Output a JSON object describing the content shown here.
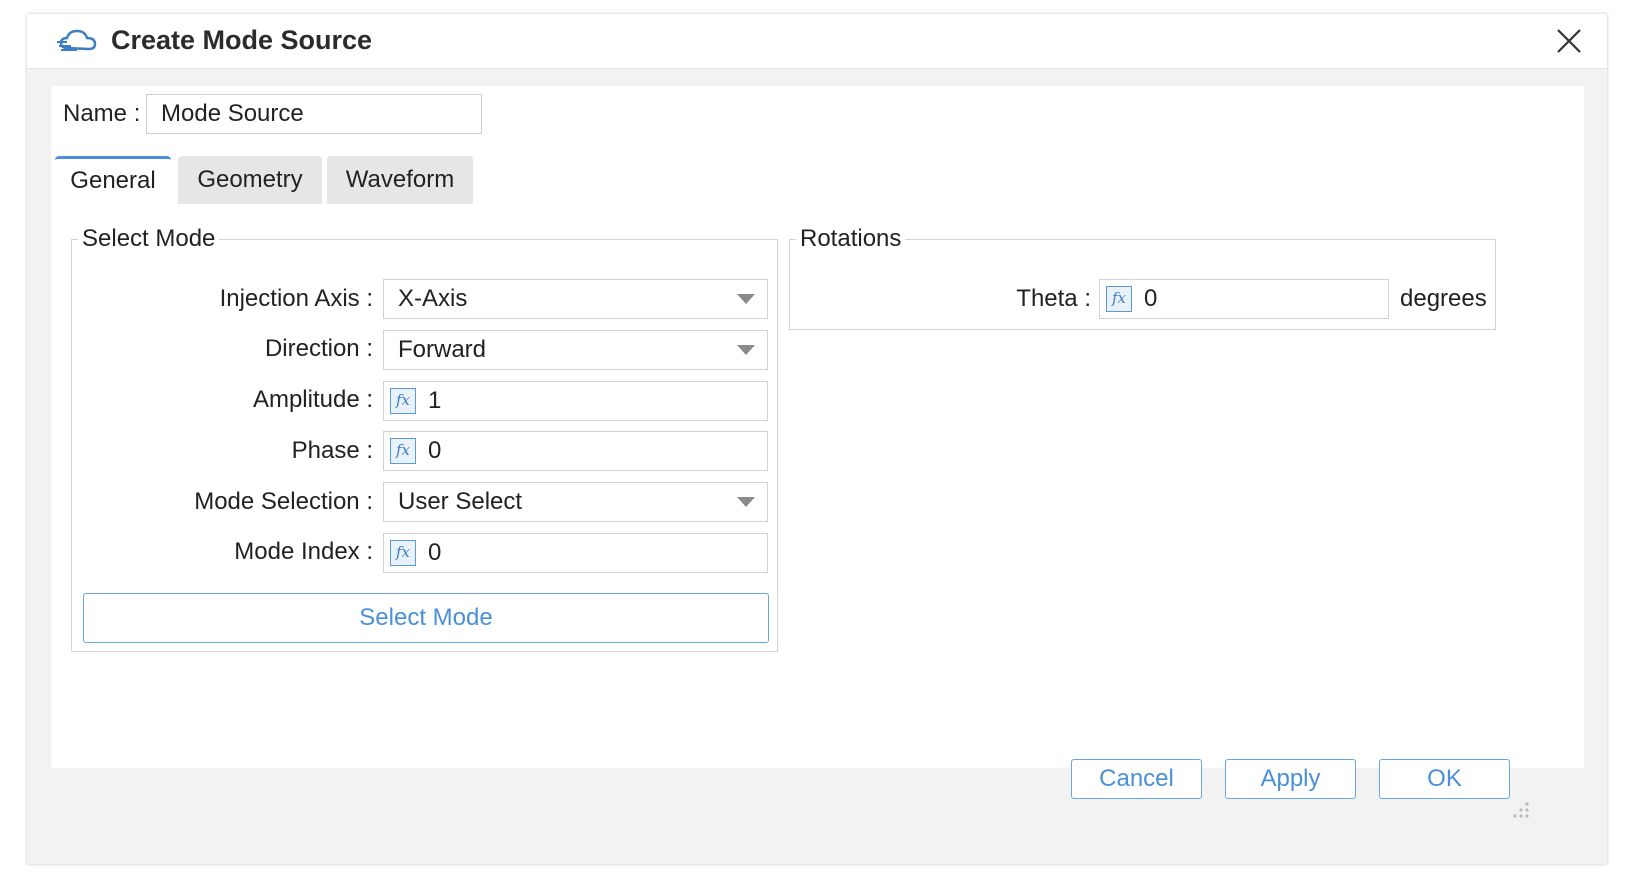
{
  "window": {
    "title": "Create Mode Source",
    "title_icon": "cloud-icon",
    "close_icon": "close-icon"
  },
  "name_field": {
    "label": "Name :",
    "value": "Mode Source"
  },
  "tabs": [
    {
      "label": "General",
      "active": true
    },
    {
      "label": "Geometry",
      "active": false
    },
    {
      "label": "Waveform",
      "active": false
    }
  ],
  "select_mode_group": {
    "legend": "Select Mode",
    "injection_axis": {
      "label": "Injection Axis :",
      "value": "X-Axis"
    },
    "direction": {
      "label": "Direction :",
      "value": "Forward"
    },
    "amplitude": {
      "label": "Amplitude :",
      "value": "1"
    },
    "phase": {
      "label": "Phase :",
      "value": "0"
    },
    "mode_selection": {
      "label": "Mode Selection :",
      "value": "User Select"
    },
    "mode_index": {
      "label": "Mode Index :",
      "value": "0"
    },
    "button_label": "Select Mode"
  },
  "rotations_group": {
    "legend": "Rotations",
    "theta": {
      "label": "Theta :",
      "value": "0",
      "unit": "degrees"
    }
  },
  "fx_glyph": "fx",
  "footer": {
    "cancel_label": "Cancel",
    "apply_label": "Apply",
    "ok_label": "OK"
  },
  "colors": {
    "accent": "#4a90d9",
    "fx_icon": "#3c7dc4"
  }
}
